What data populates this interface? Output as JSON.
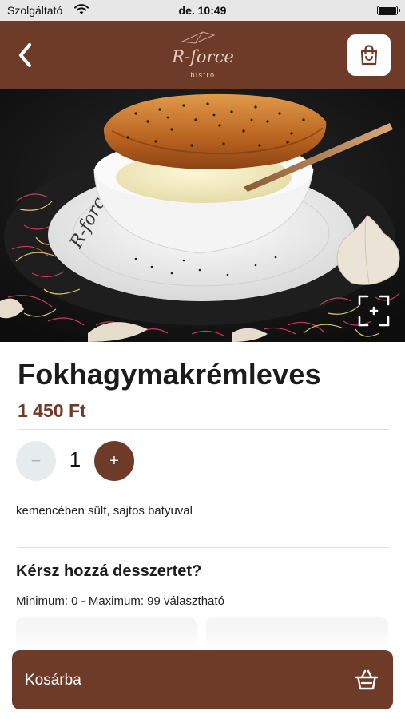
{
  "status_bar": {
    "carrier": "Szolgáltató",
    "time": "de. 10:49"
  },
  "header": {
    "logo_text": "R-force",
    "logo_subtext": "bistro",
    "background": "#6e3b29"
  },
  "product": {
    "name": "Fokhagymakrémleves",
    "price": "1 450 Ft",
    "quantity": "1",
    "minus_label": "−",
    "plus_label": "+",
    "description": "kemencében sült, sajtos batyuval",
    "plate_text": "R-force"
  },
  "addon": {
    "title": "Kérsz hozzá desszertet?",
    "limits": "Minimum: 0 - Maximum: 99 választható"
  },
  "cta": {
    "label": "Kosárba"
  },
  "icons": {
    "back": "chevron-left-icon",
    "cart": "shopping-bag-icon",
    "expand": "expand-icon",
    "basket": "basket-icon"
  },
  "colors": {
    "brand": "#6e3b29",
    "minus_bg": "#e6ebee",
    "white": "#ffffff"
  }
}
